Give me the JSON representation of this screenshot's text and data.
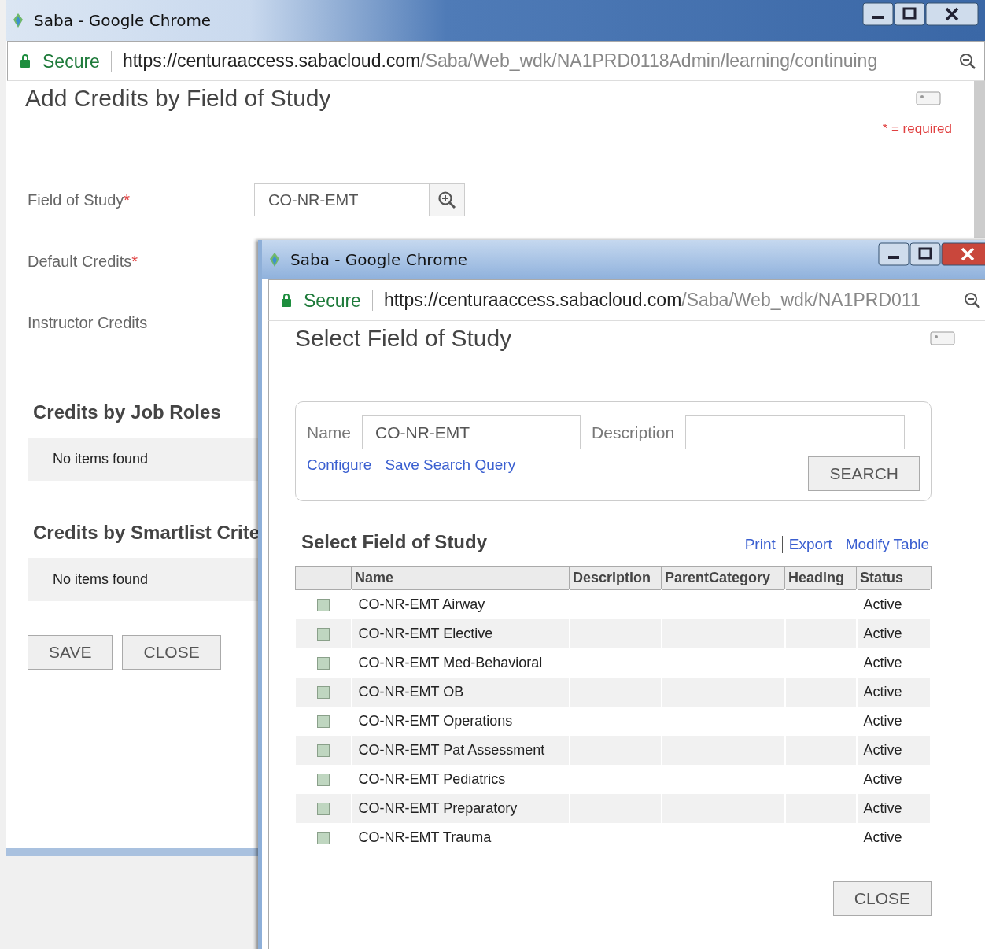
{
  "main_window": {
    "title": "Saba - Google Chrome",
    "secure_label": "Secure",
    "url": {
      "host": "https://centuraaccess.sabacloud.com",
      "path": "/Saba/Web_wdk/NA1PRD0118Admin/learning/continuing"
    },
    "heading": "Add Credits by Field of Study",
    "required_note": "* = required",
    "required_mark": "*",
    "fields": [
      {
        "label": "Field of Study",
        "required": true,
        "kind": "lookup",
        "value": "CO-NR-EMT"
      },
      {
        "label": "Default Credits",
        "required": true,
        "kind": "hidden"
      },
      {
        "label": "Instructor Credits",
        "required": false,
        "kind": "hidden"
      }
    ],
    "sections": [
      {
        "title": "Credits by Job Roles",
        "empty_text": "No items found"
      },
      {
        "title": "Credits by Smartlist Crite",
        "empty_text": "No items found"
      }
    ],
    "buttons": [
      "SAVE",
      "CLOSE"
    ]
  },
  "popup_window": {
    "title": "Saba - Google Chrome",
    "secure_label": "Secure",
    "url": {
      "host": "https://centuraaccess.sabacloud.com",
      "path": "/Saba/Web_wdk/NA1PRD011"
    },
    "heading": "Select Field of Study",
    "search": {
      "name_label": "Name",
      "name_value": "CO-NR-EMT",
      "description_label": "Description",
      "links": [
        "Configure",
        "Save Search Query"
      ],
      "button": "SEARCH"
    },
    "results_title": "Select Field of Study",
    "table_links": [
      "Print",
      "Export",
      "Modify Table"
    ],
    "table": {
      "columns": [
        "Name",
        "Description",
        "ParentCategory",
        "Heading",
        "Status"
      ],
      "rows": [
        {
          "checked": false,
          "cells": [
            "CO-NR-EMT Airway",
            "",
            "",
            "",
            "Active"
          ]
        },
        {
          "checked": false,
          "cells": [
            "CO-NR-EMT Elective",
            "",
            "",
            "",
            "Active"
          ]
        },
        {
          "checked": false,
          "cells": [
            "CO-NR-EMT Med-Behavioral",
            "",
            "",
            "",
            "Active"
          ]
        },
        {
          "checked": false,
          "cells": [
            "CO-NR-EMT OB",
            "",
            "",
            "",
            "Active"
          ]
        },
        {
          "checked": false,
          "cells": [
            "CO-NR-EMT Operations",
            "",
            "",
            "",
            "Active"
          ]
        },
        {
          "checked": false,
          "cells": [
            "CO-NR-EMT Pat Assessment",
            "",
            "",
            "",
            "Active"
          ]
        },
        {
          "checked": false,
          "cells": [
            "CO-NR-EMT Pediatrics",
            "",
            "",
            "",
            "Active"
          ]
        },
        {
          "checked": false,
          "cells": [
            "CO-NR-EMT Preparatory",
            "",
            "",
            "",
            "Active"
          ]
        },
        {
          "checked": false,
          "cells": [
            "CO-NR-EMT Trauma",
            "",
            "",
            "",
            "Active"
          ]
        }
      ]
    },
    "close_button": "CLOSE"
  }
}
